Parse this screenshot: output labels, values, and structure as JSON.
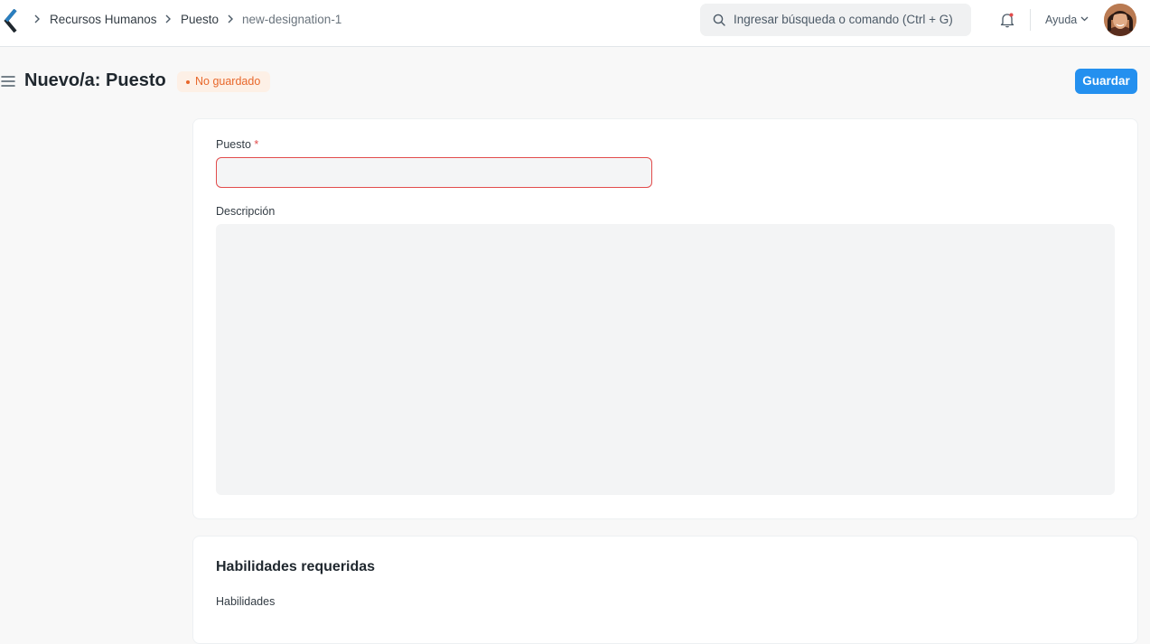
{
  "navbar": {
    "breadcrumbs": [
      "Recursos Humanos",
      "Puesto",
      "new-designation-1"
    ],
    "search": {
      "placeholder": "Ingresar búsqueda o comando (Ctrl + G)"
    },
    "help_label": "Ayuda"
  },
  "page": {
    "title": "Nuevo/a: Puesto",
    "status": "No guardado",
    "save_label": "Guardar"
  },
  "form": {
    "designation": {
      "label": "Puesto",
      "required_mark": "*",
      "value": ""
    },
    "description": {
      "label": "Descripción",
      "value": ""
    }
  },
  "skills_section": {
    "title": "Habilidades requeridas",
    "field_label": "Habilidades"
  },
  "colors": {
    "primary": "#2490ef",
    "status_orange": "#e8672a",
    "required_red": "#e24c4c",
    "logo_blue": "#2a7fc0"
  },
  "icons": {
    "logo": "frappe-back-logo",
    "search": "search-icon",
    "notifications": "bell-icon",
    "menu": "hamburger-icon"
  }
}
